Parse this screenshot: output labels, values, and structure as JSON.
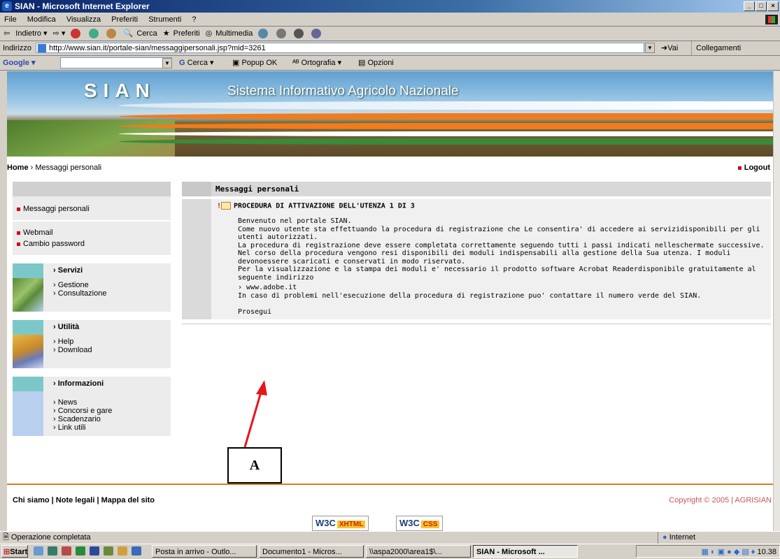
{
  "window": {
    "title": "SIAN - Microsoft Internet Explorer",
    "controls": [
      "_",
      "□",
      "×"
    ]
  },
  "menu": [
    "File",
    "Modifica",
    "Visualizza",
    "Preferiti",
    "Strumenti",
    "?"
  ],
  "toolbar": {
    "back": "Indietro",
    "search": "Cerca",
    "favorites": "Preferiti",
    "media": "Multimedia"
  },
  "address": {
    "label": "Indirizzo",
    "url": "http://www.sian.it/portale-sian/messaggipersonali.jsp?mid=3261",
    "go": "Vai",
    "links": "Collegamenti"
  },
  "google_bar": {
    "brand": "Google",
    "search": "Cerca",
    "popup": "Popup OK",
    "spell": "Ortografia",
    "options": "Opzioni"
  },
  "banner": {
    "logo": "SIAN",
    "title": "Sistema Informativo Agricolo Nazionale"
  },
  "breadcrumb": {
    "home": "Home",
    "current": "Messaggi personali"
  },
  "logout": "Logout",
  "sidebar": {
    "top_items": [
      "Messaggi personali"
    ],
    "account_items": [
      "Webmail",
      "Cambio password"
    ],
    "sections": [
      {
        "title": "Servizi",
        "items": [
          "Gestione",
          "Consultazione"
        ]
      },
      {
        "title": "Utilità",
        "items": [
          "Help",
          "Download"
        ]
      },
      {
        "title": "Informazioni",
        "items": [
          "News",
          "Concorsi e gare",
          "Scadenzario",
          "Link utili"
        ]
      }
    ]
  },
  "main": {
    "heading": "Messaggi personali",
    "message_title": "PROCEDURA DI ATTIVAZIONE DELL'UTENZA 1 DI 3",
    "paragraphs": [
      "Benvenuto nel portale SIAN.",
      "Come nuovo utente sta effettuando la procedura di registrazione che Le consentira' di accedere ai servizidisponibili per gli utenti autorizzati.",
      "La procedura di registrazione deve essere completata correttamente seguendo tutti i passi indicati nelleschermate successive. Nel corso della procedura vengono resi disponibili dei moduli indispensabili alla gestione della Sua utenza. I moduli devonoessere scaricati e conservati in modo riservato.",
      "Per la visualizzazione e la stampa dei moduli e' necessario il prodotto software Acrobat Readerdisponibile gratuitamente al seguente indirizzo"
    ],
    "link": "www.adobe.it",
    "help_text": "In caso di problemi nell'esecuzione della procedura di registrazione puo' contattare il numero verde del SIAN.",
    "continue": "Prosegui"
  },
  "annotation": {
    "label": "A",
    "arrow_color": "#e8141c"
  },
  "footer": {
    "links": [
      "Chi siamo",
      "Note legali",
      "Mappa del sito"
    ],
    "copyright": "Copyright © 2005 | AGRISIAN",
    "badges": [
      "XHTML",
      "CSS"
    ],
    "badge_prefix": "W3C"
  },
  "status": {
    "text": "Operazione completata",
    "zone": "Internet"
  },
  "taskbar": {
    "start": "Start",
    "tasks": [
      "Posta in arrivo - Outlo...",
      "Documento1 - Micros...",
      "\\\\aspa2000\\area1$\\...",
      "SIAN - Microsoft ..."
    ],
    "clock": "10.38"
  },
  "colors": {
    "accent_red": "#d0021b",
    "footer_orange": "#e07a1e",
    "title_blue": "#0a246a"
  }
}
